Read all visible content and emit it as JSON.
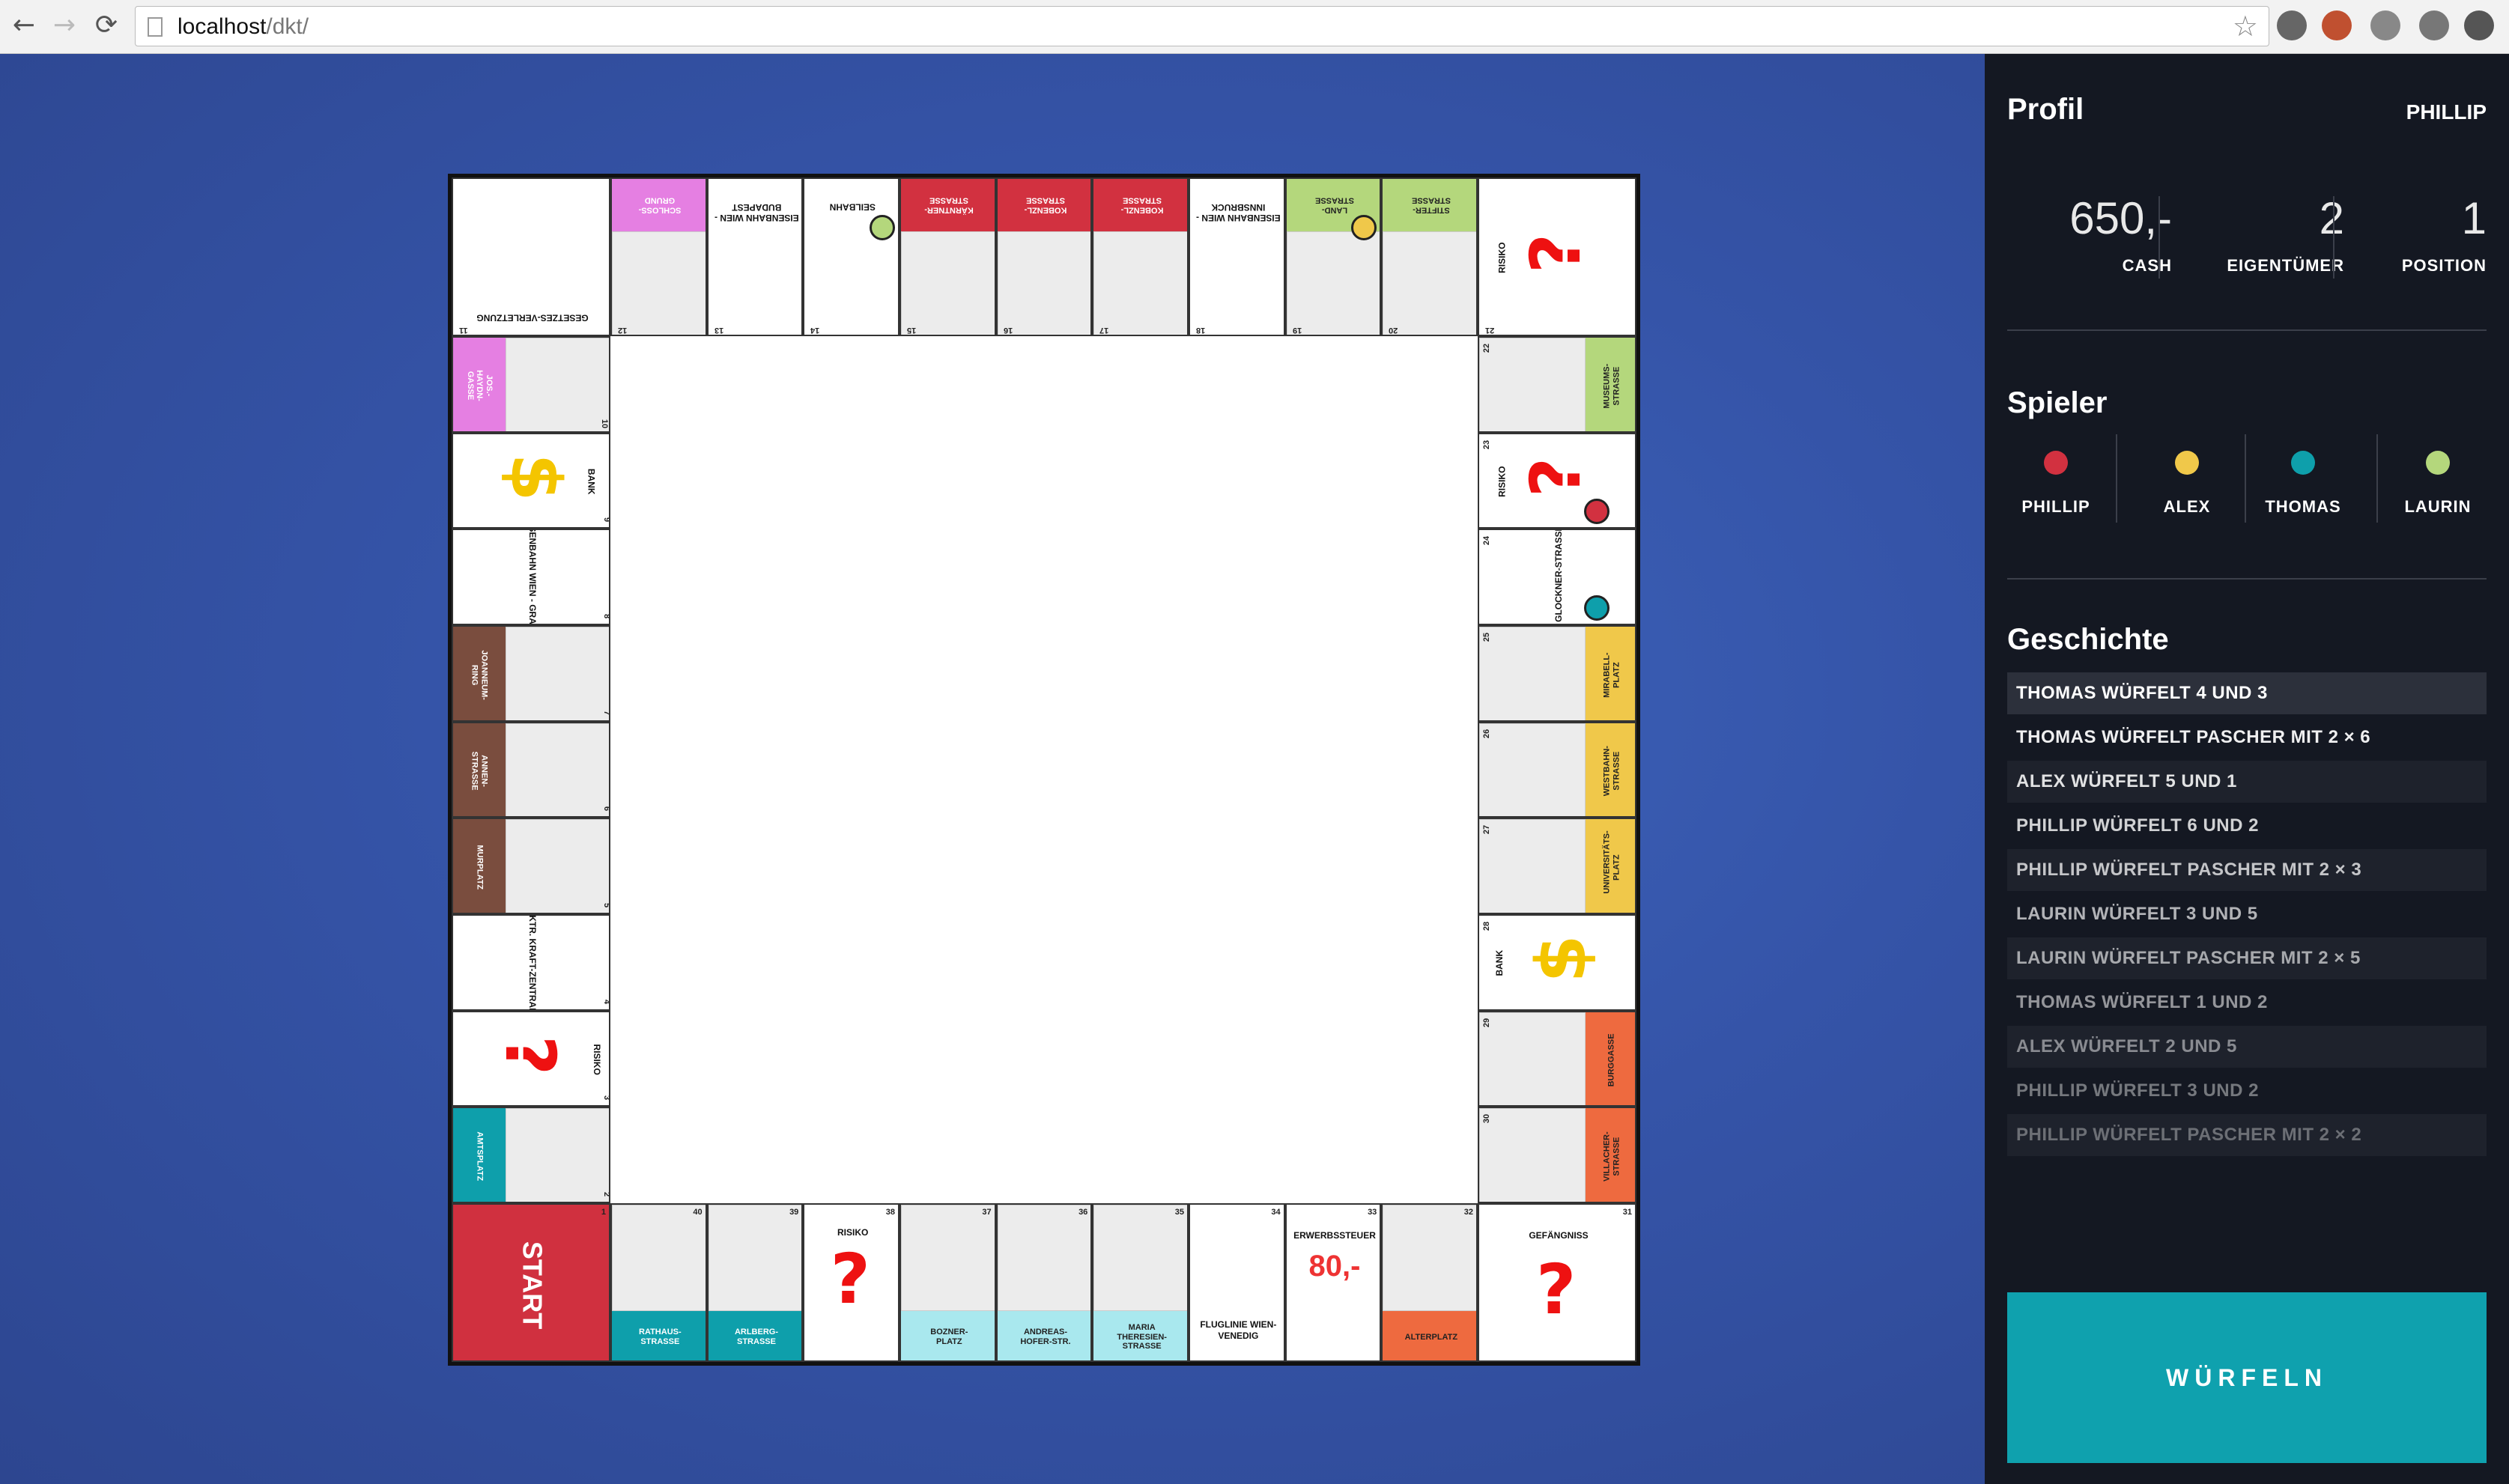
{
  "browser": {
    "url_host": "localhost",
    "url_path": "/dkt/",
    "back": "←",
    "forward": "→",
    "reload": "⟳",
    "star": "☆"
  },
  "board": {
    "top": [
      {
        "num": "11",
        "label": "GESETZES-VERLETZUNG",
        "color": "",
        "type": "corner"
      },
      {
        "num": "12",
        "label": "SCHLOSS-GRUND",
        "color": "#e57fe2",
        "type": "street"
      },
      {
        "num": "13",
        "label": "EISENBAHN WIEN - BUDAPEST",
        "color": "",
        "type": "plain"
      },
      {
        "num": "14",
        "label": "SEILBAHN",
        "color": "",
        "type": "plain"
      },
      {
        "num": "15",
        "label": "KÄRNTNER-STRASSE",
        "color": "#d23140",
        "type": "street"
      },
      {
        "num": "16",
        "label": "KOBENZL-STRASSE",
        "color": "#d23140",
        "type": "street"
      },
      {
        "num": "17",
        "label": "KOBENZL-STRASSE",
        "color": "#d23140",
        "type": "street"
      },
      {
        "num": "18",
        "label": "EISENBAHN WIEN - INNSBRUCK",
        "color": "",
        "type": "plain"
      },
      {
        "num": "19",
        "label": "LAND-STRASSE",
        "color": "#b4d77c",
        "type": "street"
      },
      {
        "num": "20",
        "label": "STIFTER-STRASSE",
        "color": "#b4d77c",
        "type": "street"
      },
      {
        "num": "21",
        "label": "RISIKO",
        "color": "",
        "type": "risk-corner"
      }
    ],
    "right": [
      {
        "num": "22",
        "label": "MUSEUMS-STRASSE",
        "color": "#b4d77c",
        "type": "street"
      },
      {
        "num": "23",
        "label": "RISIKO",
        "color": "",
        "type": "risk"
      },
      {
        "num": "24",
        "label": "GLOCKNER-STRASSE",
        "color": "",
        "type": "plain"
      },
      {
        "num": "25",
        "label": "MIRABELL-PLATZ",
        "color": "#f0c84a",
        "type": "street"
      },
      {
        "num": "26",
        "label": "WESTBAHN-STRASSE",
        "color": "#f0c84a",
        "type": "street"
      },
      {
        "num": "27",
        "label": "UNIVERSITÄTS-PLATZ",
        "color": "#f0c84a",
        "type": "street"
      },
      {
        "num": "28",
        "label": "BANK",
        "color": "",
        "type": "bank"
      },
      {
        "num": "29",
        "label": "BURGGASSE",
        "color": "#ee6a3f",
        "type": "street"
      },
      {
        "num": "30",
        "label": "VILLACHER-STRASSE",
        "color": "#ee6a3f",
        "type": "street"
      }
    ],
    "bottom": [
      {
        "num": "31",
        "label": "GEFÄNGNISS",
        "color": "",
        "type": "jail"
      },
      {
        "num": "32",
        "label": "ALTERPLATZ",
        "color": "#ee6a3f",
        "type": "street"
      },
      {
        "num": "33",
        "label": "ERWERBSSTEUER",
        "price": "80,-",
        "color": "",
        "type": "tax"
      },
      {
        "num": "34",
        "label": "FLUGLINIE WIEN-VENEDIG",
        "color": "",
        "type": "plain"
      },
      {
        "num": "35",
        "label": "MARIA THERESIEN-STRASSE",
        "color": "#a9e8ee",
        "type": "street"
      },
      {
        "num": "36",
        "label": "ANDREAS-HOFER-STR.",
        "color": "#a9e8ee",
        "type": "street"
      },
      {
        "num": "37",
        "label": "BOZNER-PLATZ",
        "color": "#a9e8ee",
        "type": "street"
      },
      {
        "num": "38",
        "label": "RISIKO",
        "color": "",
        "type": "risk"
      },
      {
        "num": "39",
        "label": "ARLBERG-STRASSE",
        "color": "#0e9fab",
        "type": "street"
      },
      {
        "num": "40",
        "label": "RATHAUS-STRASSE",
        "color": "#0e9fab",
        "type": "street"
      },
      {
        "num": "1",
        "label": "START",
        "color": "#d0303f",
        "type": "start"
      }
    ],
    "left": [
      {
        "num": "10",
        "label": "JOS.-HAYDN-GASSE",
        "color": "#e57fe2",
        "type": "street"
      },
      {
        "num": "9",
        "label": "BANK",
        "color": "",
        "type": "bank"
      },
      {
        "num": "8",
        "label": "EISENBAHN WIEN - GRAZ",
        "color": "",
        "type": "plain"
      },
      {
        "num": "7",
        "label": "JOANNEUM-RING",
        "color": "#7a4d3e",
        "type": "street"
      },
      {
        "num": "6",
        "label": "ANNEN-STRASSE",
        "color": "#7a4d3e",
        "type": "street"
      },
      {
        "num": "5",
        "label": "MURPLATZ",
        "color": "#7a4d3e",
        "type": "street"
      },
      {
        "num": "4",
        "label": "ELEKTR. KRAFT-ZENTRALE",
        "color": "",
        "type": "plain"
      },
      {
        "num": "3",
        "label": "RISIKO",
        "color": "",
        "type": "risk"
      },
      {
        "num": "2",
        "label": "AMTSPLATZ",
        "color": "#0e9fab",
        "type": "street"
      }
    ],
    "tokens": [
      {
        "field": "14",
        "color": "#b4d77c",
        "side": "top"
      },
      {
        "field": "19",
        "color": "#f0c84a",
        "side": "top"
      },
      {
        "field": "23",
        "color": "#d23140",
        "side": "right"
      },
      {
        "field": "24",
        "color": "#0e9fab",
        "side": "right"
      }
    ]
  },
  "profile": {
    "title": "Profil",
    "name": "PHILLIP",
    "cash_value": "650,-",
    "cash_label": "CASH",
    "owner_value": "2",
    "owner_label": "EIGENTÜMER",
    "position_value": "1",
    "position_label": "POSITION"
  },
  "players": {
    "title": "Spieler",
    "list": [
      {
        "name": "PHILLIP",
        "color": "#d23140"
      },
      {
        "name": "ALEX",
        "color": "#f0c84a"
      },
      {
        "name": "THOMAS",
        "color": "#0e9fab"
      },
      {
        "name": "LAURIN",
        "color": "#b4d77c"
      }
    ]
  },
  "history": {
    "title": "Geschichte",
    "entries": [
      "THOMAS WÜRFELT 4 UND 3",
      "THOMAS WÜRFELT PASCHER MIT 2 × 6",
      "ALEX WÜRFELT 5 UND 1",
      "PHILLIP WÜRFELT 6 UND 2",
      "PHILLIP WÜRFELT PASCHER MIT 2 × 3",
      "LAURIN WÜRFELT 3 UND 5",
      "LAURIN WÜRFELT PASCHER MIT 2 × 5",
      "THOMAS WÜRFELT 1 UND 2",
      "ALEX WÜRFELT 2 UND 5",
      "PHILLIP WÜRFELT 3 UND 2",
      "PHILLIP WÜRFELT PASCHER MIT 2 × 2"
    ]
  },
  "roll_button": "WÜRFELN"
}
